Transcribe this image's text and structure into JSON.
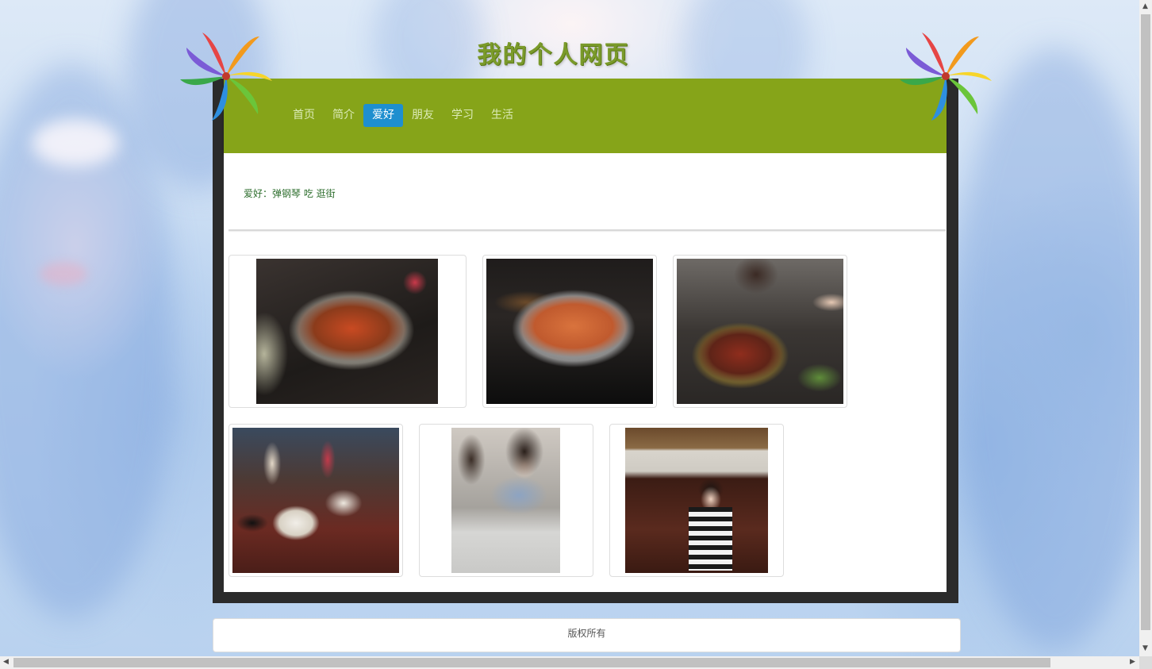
{
  "page": {
    "title": "我的个人网页",
    "hobby_text": "爱好：弹钢琴 吃 逛街",
    "footer": "版权所有"
  },
  "nav": {
    "items": [
      {
        "label": "首页",
        "active": false
      },
      {
        "label": "简介",
        "active": false
      },
      {
        "label": "爱好",
        "active": true
      },
      {
        "label": "朋友",
        "active": false
      },
      {
        "label": "学习",
        "active": false
      },
      {
        "label": "生活",
        "active": false
      }
    ]
  },
  "gallery": [
    {
      "subject": "spicy-pot-photo"
    },
    {
      "subject": "fish-stew-photo"
    },
    {
      "subject": "hotpot-friends-photo"
    },
    {
      "subject": "cake-drinks-photo"
    },
    {
      "subject": "piano-friends-photo"
    },
    {
      "subject": "girl-at-piano-photo"
    }
  ],
  "colors": {
    "header": "#86a419",
    "active_tab": "#1e8fcf",
    "frame": "#2b2b2b",
    "title": "#7a9a2a"
  }
}
